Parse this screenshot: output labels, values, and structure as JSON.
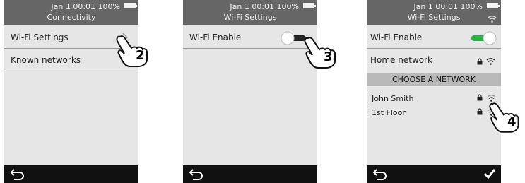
{
  "status": {
    "date": "Jan",
    "day": "1",
    "time": "00:01",
    "battery": "100%"
  },
  "screens": [
    {
      "title": "Connectivity",
      "rows": [
        "Wi-Fi Settings",
        "Known networks"
      ],
      "step": "2"
    },
    {
      "title": "Wi-Fi Settings",
      "wifi_enable_label": "Wi-Fi Enable",
      "toggle_state": "off",
      "step": "3"
    },
    {
      "title": "Wi-Fi Settings",
      "wifi_enable_label": "Wi-Fi Enable",
      "toggle_state": "on",
      "home_network": "Home network",
      "section_header": "CHOOSE A NETWORK",
      "networks": [
        "John Smith",
        "1st Floor"
      ],
      "step": "4"
    }
  ],
  "colors": {
    "accent": "#27b24a",
    "statusbar": "#666666",
    "bottombar": "#111111",
    "screen_bg": "#e6e6e6"
  },
  "icons": [
    "battery-icon",
    "chevron-right-icon",
    "back-arrow-icon",
    "checkmark-icon",
    "lock-icon",
    "wifi-icon",
    "pointing-hand-icon"
  ]
}
